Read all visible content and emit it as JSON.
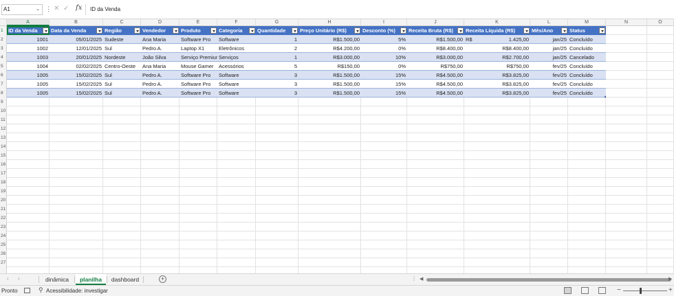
{
  "formula_bar": {
    "name_box": "A1",
    "fx": "fx",
    "content": "ID da Venda"
  },
  "columns": [
    "A",
    "B",
    "C",
    "D",
    "E",
    "F",
    "G",
    "H",
    "I",
    "J",
    "K",
    "L",
    "M",
    "N",
    "O"
  ],
  "rows": [
    "1",
    "2",
    "3",
    "4",
    "5",
    "6",
    "7",
    "8",
    "9",
    "10",
    "11",
    "12",
    "13",
    "14",
    "15",
    "16",
    "17",
    "18",
    "19",
    "20",
    "21",
    "22",
    "23",
    "24",
    "25",
    "26",
    "27"
  ],
  "table": {
    "headers": [
      "ID da Venda",
      "Data da Venda",
      "Região",
      "Vendedor",
      "Produto",
      "Categoria",
      "Quantidade",
      "Preço Unitário (R$)",
      "Desconto (%)",
      "Receita Bruta (R$)",
      "Receita Líquida (R$)",
      "Mês/Ano",
      "Status"
    ],
    "rows": [
      {
        "id": "1001",
        "data": "05/01/2025",
        "regiao": "Sudeste",
        "vendedor": "Ana Maria",
        "produto": "Software Pro",
        "categoria": "Software",
        "qtd": "1",
        "preco": "R$1.500,00",
        "desconto": "5%",
        "bruta": "R$1.500,00",
        "liquida_cur": "R$",
        "liquida": "1.425,00",
        "mes": "jan/25",
        "status": "Concluído"
      },
      {
        "id": "1002",
        "data": "12/01/2025",
        "regiao": "Sul",
        "vendedor": "Pedro A.",
        "produto": "Laptop X1",
        "categoria": "Eletrônicos",
        "qtd": "2",
        "preco": "R$4.200,00",
        "desconto": "0%",
        "bruta": "R$8.400,00",
        "liquida_cur": "",
        "liquida": "R$8.400,00",
        "mes": "jan/25",
        "status": "Concluído"
      },
      {
        "id": "1003",
        "data": "20/01/2025",
        "regiao": "Nordeste",
        "vendedor": "João Silva",
        "produto": "Serviço Premium",
        "categoria": "Serviços",
        "qtd": "1",
        "preco": "R$3.000,00",
        "desconto": "10%",
        "bruta": "R$3.000,00",
        "liquida_cur": "",
        "liquida": "R$2.700,00",
        "mes": "jan/25",
        "status": "Cancelado"
      },
      {
        "id": "1004",
        "data": "02/02/2025",
        "regiao": "Centro-Oeste",
        "vendedor": "Ana Maria",
        "produto": "Mouse Gamer",
        "categoria": "Acessórios",
        "qtd": "5",
        "preco": "R$150,00",
        "desconto": "0%",
        "bruta": "R$750,00",
        "liquida_cur": "",
        "liquida": "R$750,00",
        "mes": "fev/25",
        "status": "Concluído"
      },
      {
        "id": "1005",
        "data": "15/02/2025",
        "regiao": "Sul",
        "vendedor": "Pedro A.",
        "produto": "Software Pro",
        "categoria": "Software",
        "qtd": "3",
        "preco": "R$1.500,00",
        "desconto": "15%",
        "bruta": "R$4.500,00",
        "liquida_cur": "",
        "liquida": "R$3.825,00",
        "mes": "fev/25",
        "status": "Concluído"
      },
      {
        "id": "1005",
        "data": "15/02/2025",
        "regiao": "Sul",
        "vendedor": "Pedro A.",
        "produto": "Software Pro",
        "categoria": "Software",
        "qtd": "3",
        "preco": "R$1.500,00",
        "desconto": "15%",
        "bruta": "R$4.500,00",
        "liquida_cur": "",
        "liquida": "R$3.825,00",
        "mes": "fev/25",
        "status": "Concluído"
      },
      {
        "id": "1005",
        "data": "15/02/2025",
        "regiao": "Sul",
        "vendedor": "Pedro A.",
        "produto": "Software Pro",
        "categoria": "Software",
        "qtd": "3",
        "preco": "R$1.500,00",
        "desconto": "15%",
        "bruta": "R$4.500,00",
        "liquida_cur": "",
        "liquida": "R$3.825,00",
        "mes": "fev/25",
        "status": "Concluído"
      }
    ]
  },
  "sheets": {
    "tabs": [
      "dinâmica",
      "planilha",
      "dashboard"
    ],
    "active": "planilha"
  },
  "status_bar": {
    "ready": "Pronto",
    "accessibility": "Acessibilidade: investigar"
  },
  "colors": {
    "header_fill": "#4472c4",
    "band_fill": "#d9e1f2",
    "accent": "#107c41"
  }
}
